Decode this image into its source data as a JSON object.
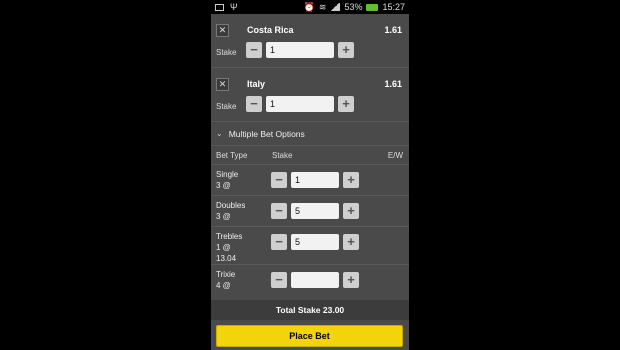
{
  "status_bar": {
    "battery": "53%",
    "time": "15:27"
  },
  "bets": [
    {
      "name": "Costa Rica",
      "odds": "1.61",
      "stake_label": "Stake",
      "stake_value": "1"
    },
    {
      "name": "Italy",
      "odds": "1.61",
      "stake_label": "Stake",
      "stake_value": "1"
    }
  ],
  "multiple_bet_options": {
    "title": "Multiple Bet Options",
    "headers": {
      "bet_type": "Bet Type",
      "stake": "Stake",
      "ew": "E/W"
    },
    "rows": [
      {
        "type": "Single",
        "detail": "3 @",
        "stake": "1"
      },
      {
        "type": "Doubles",
        "detail": "3 @",
        "stake": "5"
      },
      {
        "type": "Trebles",
        "detail": "1 @",
        "detail2": "13.04",
        "stake": "5"
      },
      {
        "type": "Trixie",
        "detail": "4 @",
        "stake": ""
      }
    ]
  },
  "footer": {
    "total_stake": "Total Stake 23.00",
    "place_bet": "Place Bet"
  },
  "colors": {
    "accent": "#f2d40b",
    "panel": "#4a4a4a",
    "battery": "#5fbf2c"
  }
}
